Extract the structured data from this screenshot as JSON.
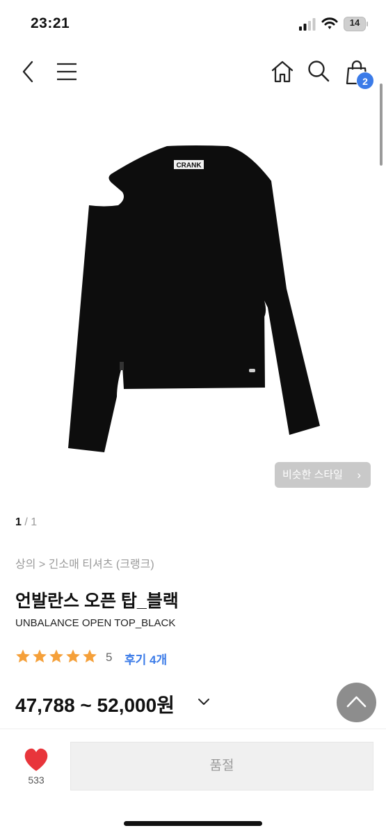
{
  "status_bar": {
    "time": "23:21",
    "battery": "14"
  },
  "header": {
    "cart_count": "2"
  },
  "gallery": {
    "brand_label": "CRANK",
    "similar_style_label": "비슷한 스타일",
    "page_current": "1",
    "page_total": "/ 1"
  },
  "product": {
    "breadcrumb": "상의 > 긴소매 티셔츠 (크랭크)",
    "title": "언발란스 오픈 탑_블랙",
    "subtitle": "UNBALANCE OPEN TOP_BLACK",
    "rating": 5,
    "rating_text": "5",
    "review_label": "후기 4개",
    "price": "47,788 ~ 52,000원"
  },
  "bottom_bar": {
    "wishlist_count": "533",
    "soldout_label": "품절"
  },
  "colors": {
    "accent": "#3b7be8",
    "star": "#f5a03a",
    "heart": "#e8353b"
  },
  "icons": [
    "back-icon",
    "menu-icon",
    "home-icon",
    "search-icon",
    "cart-icon",
    "chevron-right-icon",
    "star-icon",
    "chevron-down-icon",
    "arrow-up-icon",
    "heart-icon"
  ]
}
